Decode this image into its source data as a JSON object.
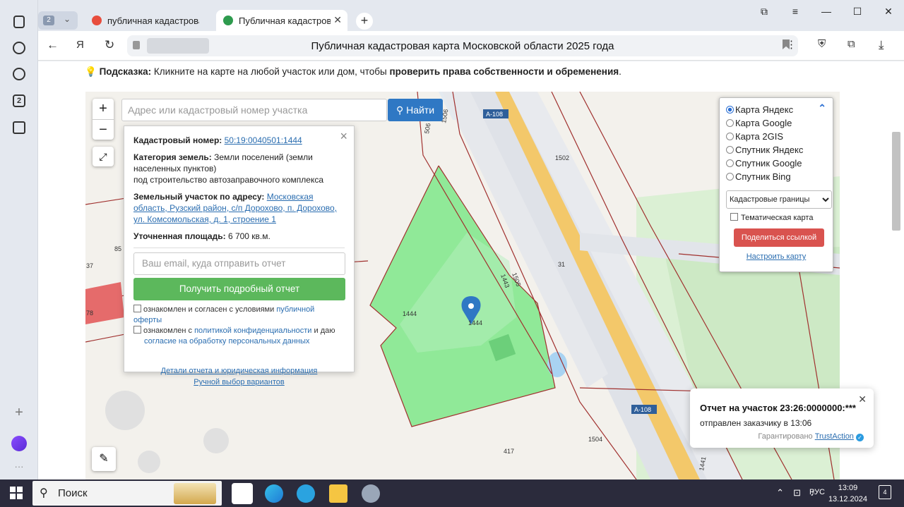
{
  "browser": {
    "tab_count": "2",
    "tabs": [
      {
        "label": "публичная кадастровая к",
        "favicon_color": "#e84d3d"
      },
      {
        "label": "Публичная кадастровая",
        "favicon_color": "#2e9b4e"
      }
    ],
    "page_title": "Публичная кадастровая карта Московской области 2025 года",
    "sidebar_badge": "2"
  },
  "hint": {
    "label": "Подсказка:",
    "text_before": " Кликните на карте на любой участок или дом, чтобы ",
    "text_bold": "проверить права собственности и обременения",
    "text_after": "."
  },
  "search": {
    "placeholder": "Адрес или кадастровый номер участка",
    "button_label": "Найти"
  },
  "zoom": {
    "plus": "+",
    "minus": "−"
  },
  "popup": {
    "cadastral_label": "Кадастровый номер:",
    "cadastral_number": "50:19:0040501:1444",
    "category_label": "Категория земель:",
    "category_value": "Земли поселений (земли населенных пунктов)",
    "category_purpose": "под строительство автозаправочного комплекса",
    "address_label": "Земельный участок по адресу:",
    "address_value": "Московская область, Рузский район, с/п Дорохово, п. Дорохово, ул. Комсомольская, д. 1, строение 1",
    "area_label": "Уточненная площадь:",
    "area_value": "6 700 кв.м.",
    "email_placeholder": "Ваш email, куда отправить отчет",
    "report_button": "Получить подробный отчет",
    "agree1_text": "ознакомлен и согласен с условиями ",
    "agree1_link": "публичной оферты",
    "agree2_text": "ознакомлен с ",
    "agree2_link1": "политикой конфиденциальности",
    "agree2_mid": " и даю",
    "agree2_link2": "согласие на обработку персональных данных",
    "details_link": "Детали отчета и юридическая информация",
    "manual_link": "Ручной выбор вариантов"
  },
  "layers": {
    "options": [
      "Карта Яндекс",
      "Карта Google",
      "Карта 2GIS",
      "Спутник Яндекс",
      "Спутник Google",
      "Спутник Bing"
    ],
    "selected": "Карта Яндекс",
    "select_value": "Кадастровые границы",
    "thematic_label": "Тематическая карта",
    "share_button": "Поделиться ссылкой",
    "settings_link": "Настроить карту"
  },
  "map_labels": {
    "road1": "А-108",
    "road2": "А-108",
    "parcel_1502": "1502",
    "parcel_1505": "1505",
    "parcel_1443": "1443",
    "parcel_31": "31",
    "parcel_1444a": "1444",
    "parcel_1444b": "1444",
    "parcel_1504": "1504",
    "parcel_417": "417",
    "parcel_1441": "1441",
    "parcel_506": "506",
    "parcel_1506": "1506",
    "parcel_85": "85",
    "parcel_37": "37",
    "parcel_78": "78"
  },
  "toast": {
    "title": "Отчет на участок 23:26:0000000:***",
    "subtitle": "отправлен заказчику в 13:06",
    "guarantee": "Гарантировано ",
    "brand": "TrustAction"
  },
  "taskbar": {
    "search_label": "Поиск",
    "lang": "РУС",
    "time": "13:09",
    "date": "13.12.2024",
    "notifications": "4"
  },
  "colors": {
    "parcel_fill": "#7ee88a",
    "boundary": "#a0302e",
    "road": "#f3c86a",
    "accent_blue": "#2f78c4",
    "report_green": "#5cb85c",
    "share_red": "#d9534f"
  }
}
